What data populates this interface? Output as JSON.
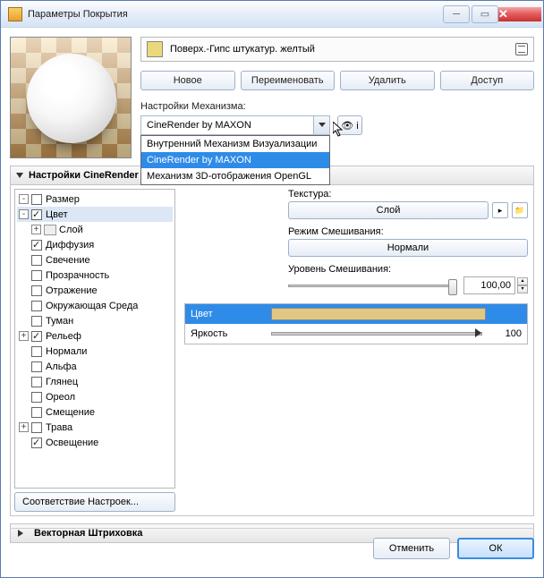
{
  "title": "Параметры Покрытия",
  "material": {
    "name": "Поверх.-Гипс штукатур. желтый"
  },
  "toolbar": {
    "new": "Новое",
    "rename": "Переименовать",
    "delete": "Удалить",
    "access": "Доступ"
  },
  "engine": {
    "label": "Настройки Механизма:",
    "selected": "CineRender by MAXON",
    "options": [
      "Внутренний Механизм Визуализации",
      "CineRender by MAXON",
      "Механизм 3D-отображения OpenGL"
    ]
  },
  "section1": "Настройки CineRender",
  "section2": "Векторная Штриховка",
  "tree": [
    {
      "depth": 0,
      "exp": "-",
      "cb": false,
      "label": "Размер"
    },
    {
      "depth": 0,
      "exp": "-",
      "cb": true,
      "label": "Цвет",
      "sel": true
    },
    {
      "depth": 1,
      "exp": "+",
      "cb": null,
      "label": "Слой",
      "icon": true
    },
    {
      "depth": 0,
      "exp": "",
      "cb": true,
      "label": "Диффузия"
    },
    {
      "depth": 0,
      "exp": "",
      "cb": false,
      "label": "Свечение"
    },
    {
      "depth": 0,
      "exp": "",
      "cb": false,
      "label": "Прозрачность"
    },
    {
      "depth": 0,
      "exp": "",
      "cb": false,
      "label": "Отражение"
    },
    {
      "depth": 0,
      "exp": "",
      "cb": false,
      "label": "Окружающая Среда"
    },
    {
      "depth": 0,
      "exp": "",
      "cb": false,
      "label": "Туман"
    },
    {
      "depth": 0,
      "exp": "+",
      "cb": true,
      "label": "Рельеф"
    },
    {
      "depth": 0,
      "exp": "",
      "cb": false,
      "label": "Нормали"
    },
    {
      "depth": 0,
      "exp": "",
      "cb": false,
      "label": "Альфа"
    },
    {
      "depth": 0,
      "exp": "",
      "cb": false,
      "label": "Глянец"
    },
    {
      "depth": 0,
      "exp": "",
      "cb": false,
      "label": "Ореол"
    },
    {
      "depth": 0,
      "exp": "",
      "cb": false,
      "label": "Смещение"
    },
    {
      "depth": 0,
      "exp": "+",
      "cb": false,
      "label": "Трава"
    },
    {
      "depth": 0,
      "exp": "",
      "cb": true,
      "label": "Освещение"
    }
  ],
  "match_btn": "Соответствие Настроек...",
  "detail": {
    "texture_label": "Текстура:",
    "layer_btn": "Слой",
    "blend_label": "Режим Смешивания:",
    "blend_value": "Нормали",
    "level_label": "Уровень Смешивания:",
    "level_value": "100,00",
    "color_label": "Цвет",
    "brightness_label": "Яркость",
    "brightness_value": "100"
  },
  "buttons": {
    "cancel": "Отменить",
    "ok": "ОК"
  }
}
